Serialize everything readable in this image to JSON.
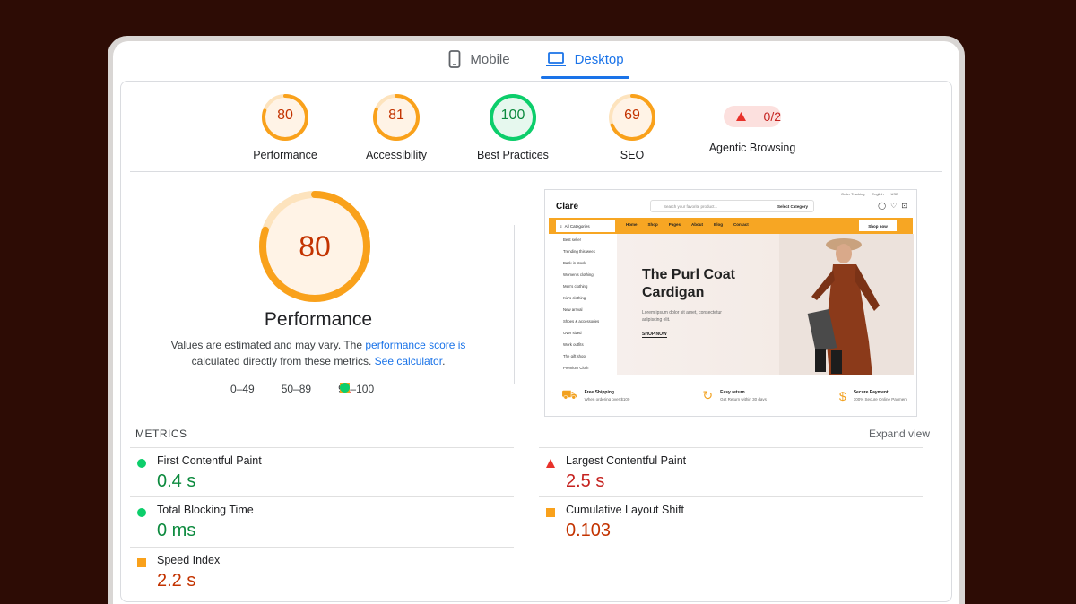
{
  "tabs": [
    {
      "label": "Mobile",
      "icon": "phone-icon",
      "active": false
    },
    {
      "label": "Desktop",
      "icon": "laptop-icon",
      "active": true
    }
  ],
  "scores": [
    {
      "label": "Performance",
      "value": "80",
      "score": 80,
      "color": "#f9a11b"
    },
    {
      "label": "Accessibility",
      "value": "81",
      "score": 81,
      "color": "#f9a11b"
    },
    {
      "label": "Best Practices",
      "value": "100",
      "score": 100,
      "color": "#0cce6b"
    },
    {
      "label": "SEO",
      "value": "69",
      "score": 69,
      "color": "#f9a11b"
    }
  ],
  "agentic": {
    "label": "Agentic Browsing",
    "value": "0/2",
    "color": "#c5221f"
  },
  "performance": {
    "score": "80",
    "score_value": 80,
    "title": "Performance",
    "desc_1": "Values are estimated and may vary. The",
    "desc_link_1": "performance score is",
    "desc_2": "calculated directly from these metrics.",
    "desc_link_2": "See calculator",
    "desc_end": ".",
    "legend": [
      "0–49",
      "50–89",
      "90–100"
    ]
  },
  "preview": {
    "logo": "Clare",
    "top_links": [
      "Order Tracking",
      "English",
      "USD"
    ],
    "search_placeholder": "Search your favorite product...",
    "search_category": "Select Category",
    "all_categories": "All Categories",
    "nav": [
      "Home",
      "Shop",
      "Pages",
      "About",
      "Blog",
      "Contact"
    ],
    "shop_now_btn": "Shop now",
    "side_items": [
      "Best seller",
      "Trending this week",
      "Back in stock",
      "Women's clothing",
      "Men's clothing",
      "Kid's clothing",
      "New arrival",
      "Shoes & accessories",
      "Over sized",
      "Work outfits",
      "The gift shop",
      "Premium Cloth"
    ],
    "hero_title_1": "The Purl Coat",
    "hero_title_2": "Cardigan",
    "hero_text": "Lorem ipsum dolor sit amet, consectetur adipiscing elit.",
    "hero_cta": "SHOP NOW",
    "features": [
      {
        "title": "Free Shipping",
        "sub": "When ordering over $100",
        "icon": "truck-icon"
      },
      {
        "title": "Easy return",
        "sub": "Get Return within 30 days",
        "icon": "return-icon"
      },
      {
        "title": "Secure Payment",
        "sub": "100% Secure Online Payment",
        "icon": "money-bag-icon"
      }
    ]
  },
  "metrics": {
    "heading": "METRICS",
    "expand": "Expand view",
    "items": [
      {
        "name": "First Contentful Paint",
        "value": "0.4 s",
        "status": "good"
      },
      {
        "name": "Largest Contentful Paint",
        "value": "2.5 s",
        "status": "poor"
      },
      {
        "name": "Total Blocking Time",
        "value": "0 ms",
        "status": "good"
      },
      {
        "name": "Cumulative Layout Shift",
        "value": "0.103",
        "status": "average"
      },
      {
        "name": "Speed Index",
        "value": "2.2 s",
        "status": "average"
      }
    ]
  }
}
